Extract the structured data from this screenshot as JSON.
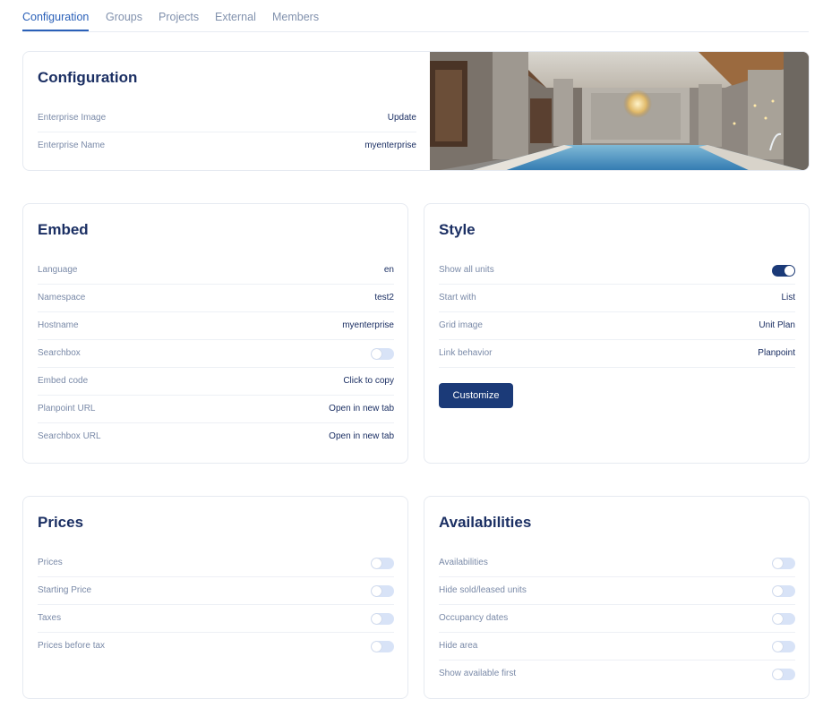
{
  "tabs": [
    {
      "label": "Configuration",
      "active": true
    },
    {
      "label": "Groups"
    },
    {
      "label": "Projects"
    },
    {
      "label": "External"
    },
    {
      "label": "Members"
    }
  ],
  "configuration": {
    "title": "Configuration",
    "rows": [
      {
        "label": "Enterprise Image",
        "value": "Update"
      },
      {
        "label": "Enterprise Name",
        "value": "myenterprise"
      }
    ]
  },
  "embed": {
    "title": "Embed",
    "rows": [
      {
        "label": "Language",
        "value": "en"
      },
      {
        "label": "Namespace",
        "value": "test2"
      },
      {
        "label": "Hostname",
        "value": "myenterprise"
      },
      {
        "label": "Searchbox",
        "toggle": false
      },
      {
        "label": "Embed code",
        "value": "Click to copy"
      },
      {
        "label": "Planpoint URL",
        "value": "Open in new tab"
      },
      {
        "label": "Searchbox URL",
        "value": "Open in new tab"
      }
    ]
  },
  "style": {
    "title": "Style",
    "rows": [
      {
        "label": "Show all units",
        "toggle": true
      },
      {
        "label": "Start with",
        "value": "List"
      },
      {
        "label": "Grid image",
        "value": "Unit Plan"
      },
      {
        "label": "Link behavior",
        "value": "Planpoint"
      }
    ],
    "button_label": "Customize"
  },
  "prices": {
    "title": "Prices",
    "rows": [
      {
        "label": "Prices",
        "toggle": false
      },
      {
        "label": "Starting Price",
        "toggle": false
      },
      {
        "label": "Taxes",
        "toggle": false
      },
      {
        "label": "Prices before tax",
        "toggle": false
      }
    ]
  },
  "availabilities": {
    "title": "Availabilities",
    "rows": [
      {
        "label": "Availabilities",
        "toggle": false
      },
      {
        "label": "Hide sold/leased units",
        "toggle": false
      },
      {
        "label": "Occupancy dates",
        "toggle": false
      },
      {
        "label": "Hide area",
        "toggle": false
      },
      {
        "label": "Show available first",
        "toggle": false
      }
    ]
  },
  "colors": {
    "accent": "#2a60b8",
    "navy": "#1b3a78",
    "toggle_off": "#d8e3f7"
  }
}
